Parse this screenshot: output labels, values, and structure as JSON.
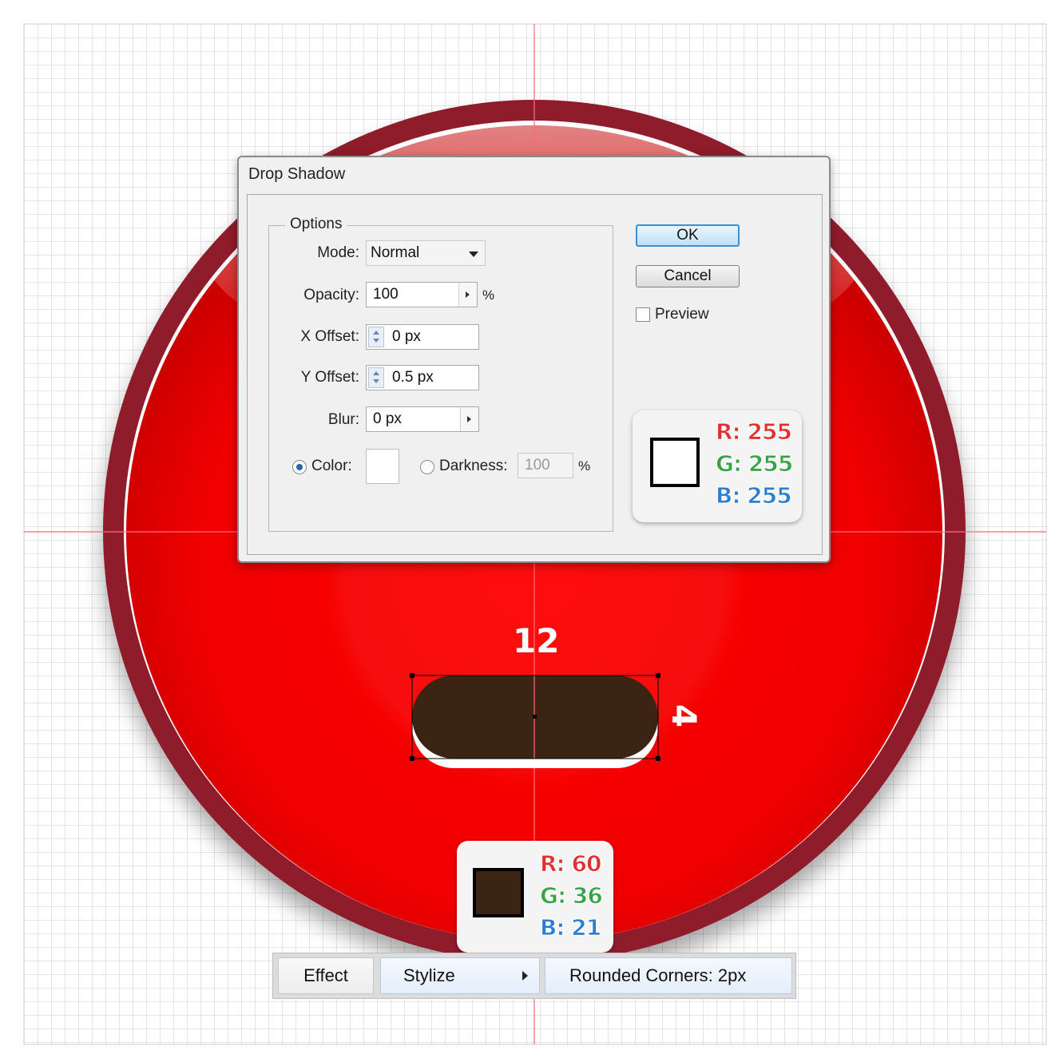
{
  "dialog": {
    "title": "Drop Shadow",
    "options_legend": "Options",
    "mode": {
      "label": "Mode:",
      "value": "Normal"
    },
    "opacity": {
      "label": "Opacity:",
      "value": "100",
      "unit": "%"
    },
    "x_offset": {
      "label": "X Offset:",
      "value": "0 px"
    },
    "y_offset": {
      "label": "Y Offset:",
      "value": "0.5 px"
    },
    "blur": {
      "label": "Blur:",
      "value": "0 px"
    },
    "color": {
      "label": "Color:",
      "selected": true,
      "swatch": "#ffffff"
    },
    "darkness": {
      "label": "Darkness:",
      "value": "100",
      "unit": "%",
      "selected": false
    },
    "ok_label": "OK",
    "cancel_label": "Cancel",
    "preview": {
      "label": "Preview",
      "checked": false
    }
  },
  "shadow_color_card": {
    "r": "R: 255",
    "g": "G: 255",
    "b": "B: 255",
    "swatch": "#ffffff"
  },
  "fill_color_card": {
    "r": "R: 60",
    "g": "G: 36",
    "b": "B: 21",
    "swatch": "#3c2415"
  },
  "dimensions": {
    "width": "12",
    "height": "4"
  },
  "menu": {
    "items": [
      {
        "label": "Effect"
      },
      {
        "label": "Stylize"
      },
      {
        "label": "Rounded Corners: 2px"
      }
    ]
  },
  "colors": {
    "badge_ring": "#8f1a2c",
    "badge_red": "#ff0000",
    "guide": "#ff6b7a",
    "grid": "#d6d6d6",
    "shape_fill": "#3c2415"
  }
}
